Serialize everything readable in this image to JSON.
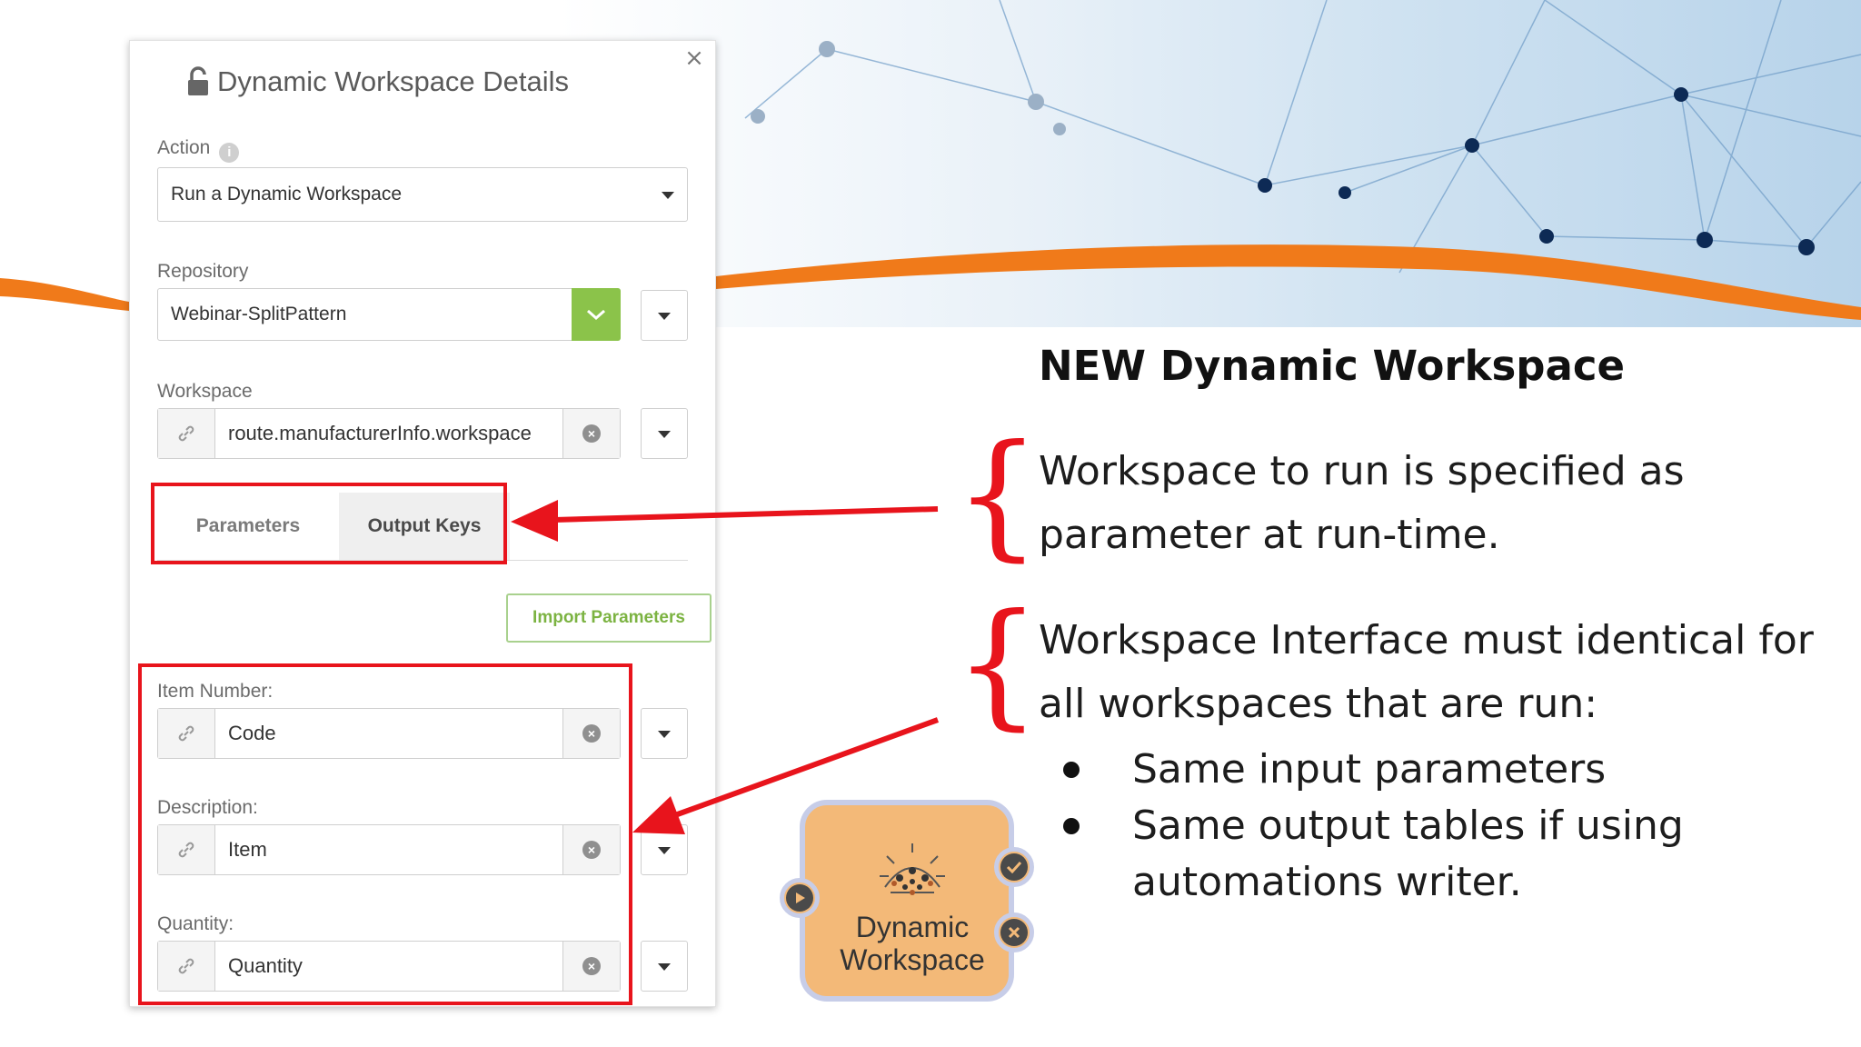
{
  "dialog": {
    "title": "Dynamic Workspace Details",
    "close_label": "×",
    "action": {
      "label": "Action",
      "info": "i",
      "value": "Run a Dynamic Workspace"
    },
    "repository": {
      "label": "Repository",
      "value": "Webinar-SplitPattern"
    },
    "workspace": {
      "label": "Workspace",
      "value": "route.manufacturerInfo.workspace"
    },
    "tabs": [
      {
        "label": "Parameters"
      },
      {
        "label": "Output Keys"
      }
    ],
    "import_button": "Import Parameters",
    "params": [
      {
        "label": "Item Number:",
        "value": "Code"
      },
      {
        "label": "Description:",
        "value": "Item"
      },
      {
        "label": "Quantity:",
        "value": "Quantity"
      }
    ]
  },
  "slide": {
    "heading": "NEW Dynamic Workspace",
    "point1": {
      "line1": "Workspace to run is specified as",
      "line2": "parameter at run-time."
    },
    "point2": {
      "line1": "Workspace Interface must identical for",
      "line2": "all workspaces that are run:"
    },
    "bullets": [
      {
        "line1": "Same input parameters"
      },
      {
        "line1": "Same output tables if using",
        "line2": "automations writer."
      }
    ]
  },
  "node": {
    "line1": "Dynamic",
    "line2": "Workspace"
  },
  "colors": {
    "accent_red": "#e8141c",
    "orange": "#f07a1a",
    "green": "#8bc34a",
    "node_fill": "#f3b978"
  },
  "icons": [
    "lock-icon",
    "info-icon",
    "chevron-down-icon",
    "link-icon",
    "clear-icon",
    "close-icon",
    "play-icon",
    "check-icon",
    "x-icon",
    "transformer-icon"
  ]
}
